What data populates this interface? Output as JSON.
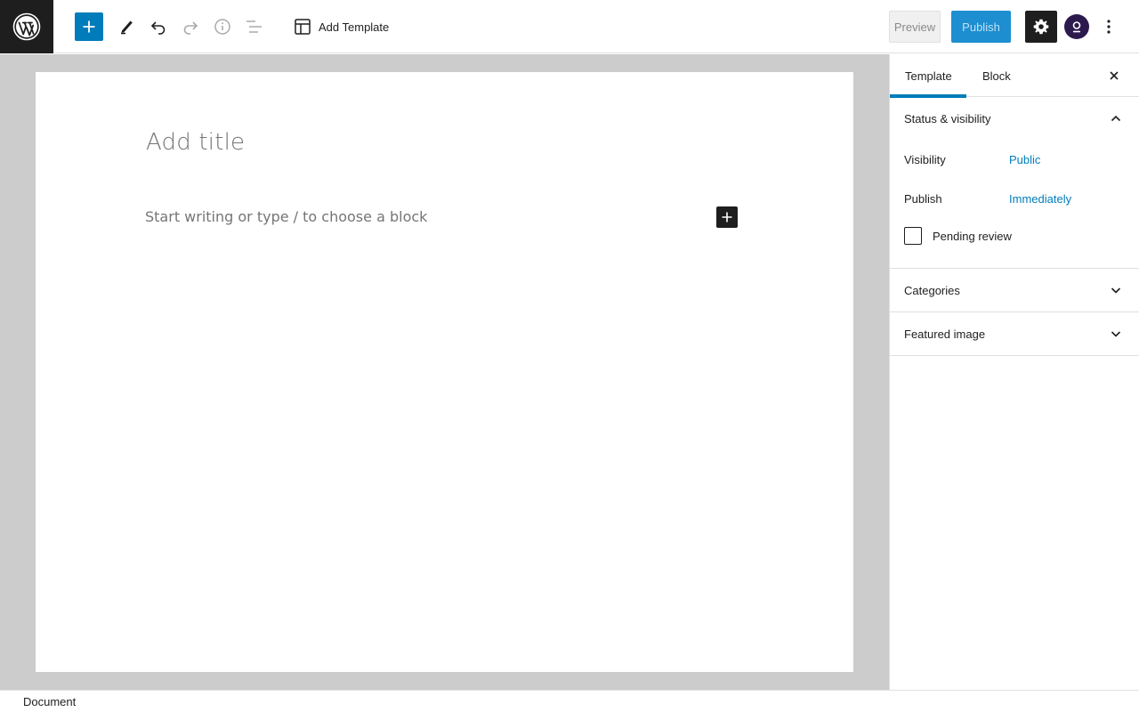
{
  "header": {
    "logo": "wordpress-logo",
    "tools": {
      "inserter": "plus-icon",
      "edit": "pencil-icon",
      "undo": "undo-icon",
      "redo": "redo-icon",
      "info": "info-icon",
      "list_view": "list-view-icon"
    },
    "document_title": "Add Template",
    "preview_label": "Preview",
    "publish_label": "Publish"
  },
  "editor": {
    "title_placeholder": "Add title",
    "block_placeholder": "Start writing or type / to choose a block"
  },
  "sidebar": {
    "tabs": [
      {
        "label": "Template",
        "active": true
      },
      {
        "label": "Block",
        "active": false
      }
    ],
    "status_visibility": {
      "title": "Status & visibility",
      "visibility_label": "Visibility",
      "visibility_value": "Public",
      "publish_label": "Publish",
      "publish_value": "Immediately",
      "pending_review_label": "Pending review"
    },
    "categories_title": "Categories",
    "featured_image_title": "Featured image"
  },
  "footer": {
    "breadcrumb": "Document"
  },
  "colors": {
    "accent": "#007cba",
    "dark": "#1e1e1e",
    "canvas_bg": "#cccccc"
  }
}
